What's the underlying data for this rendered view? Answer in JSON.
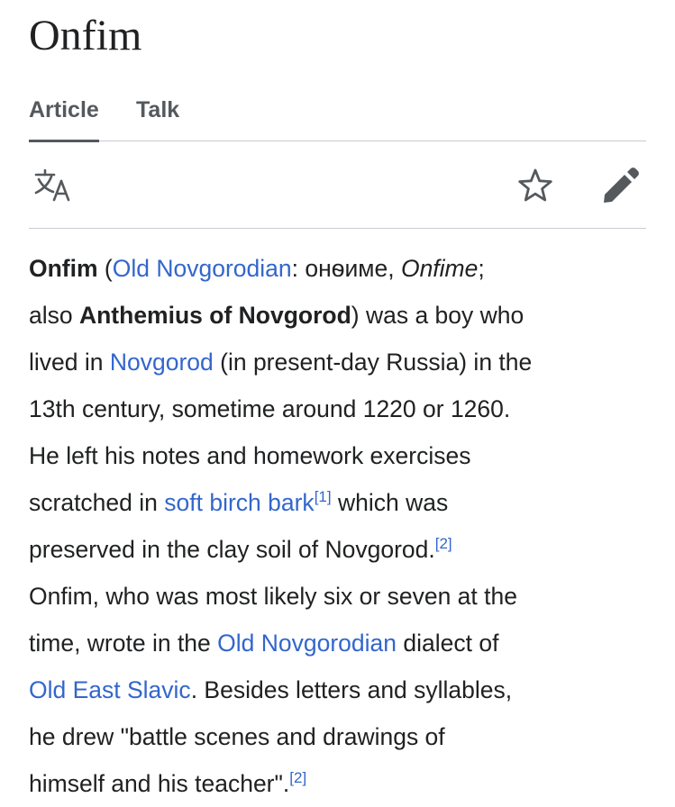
{
  "page_title": "Onfim",
  "tabs": {
    "article": "Article",
    "talk": "Talk"
  },
  "toolbar": {
    "language_icon": "language-translate-icon",
    "watch_icon": "star-outline-icon",
    "edit_icon": "pencil-icon"
  },
  "colors": {
    "text": "#202122",
    "link": "#3366cc",
    "tab_text": "#54595d",
    "divider": "#c8ccd1",
    "icon": "#54595d"
  },
  "article": {
    "subject": "Onfim",
    "p_open": " (",
    "link_old_novgorodian": "Old Novgorodian",
    "colon_cyrillic": ": онѳиме, ",
    "italic_name": "Onfime",
    "semicolon": ";",
    "also": "also ",
    "alt_name": "Anthemius of Novgorod",
    "after_alt": ") was a boy who",
    "lived_in": "lived in ",
    "link_novgorod": "Novgorod",
    "present_day": " (in present-day Russia) in the",
    "century": "13th century, sometime around 1220 or 1260.",
    "left_notes": "He left his notes and homework exercises",
    "scratched_in": "scratched in ",
    "link_birch_bark": "soft birch bark",
    "ref1": "[1]",
    "which_was": " which was",
    "preserved": "preserved in the clay soil of Novgorod.",
    "ref2a": "[2]",
    "onfim_age": "Onfim, who was most likely six or seven at the",
    "time_wrote": "time, wrote in the ",
    "link_old_novgorodian_2": "Old Novgorodian",
    "dialect_of": " dialect of",
    "link_old_east_slavic": "Old East Slavic",
    "besides": ". Besides letters and syllables,",
    "drew": "he drew \"battle scenes and drawings of",
    "himself": "himself and his teacher\".",
    "ref2b": "[2]"
  }
}
